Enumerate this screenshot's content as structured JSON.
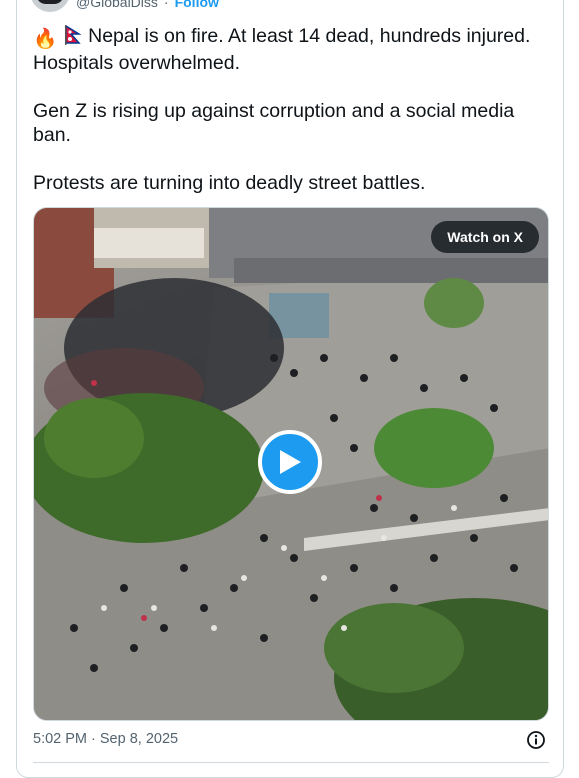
{
  "header": {
    "handle": "@GlobalDiss",
    "separator": "·",
    "follow_label": "Follow"
  },
  "tweet": {
    "line1_emoji_fire": "🔥",
    "line1_text": "Nepal is on fire. At least 14 dead, hundreds injured. Hospitals overwhelmed.",
    "paragraph2": "Gen Z is rising up against corruption and a social media ban.",
    "paragraph3": "Protests are turning into deadly street battles."
  },
  "media": {
    "watch_label": "Watch on X",
    "play_icon": "play-icon"
  },
  "footer": {
    "timestamp": "5:02 PM · Sep 8, 2025",
    "info_icon": "info-icon"
  },
  "colors": {
    "accent": "#1d9bf0",
    "text": "#0f1419",
    "muted": "#536471",
    "border": "#cfd9de"
  }
}
